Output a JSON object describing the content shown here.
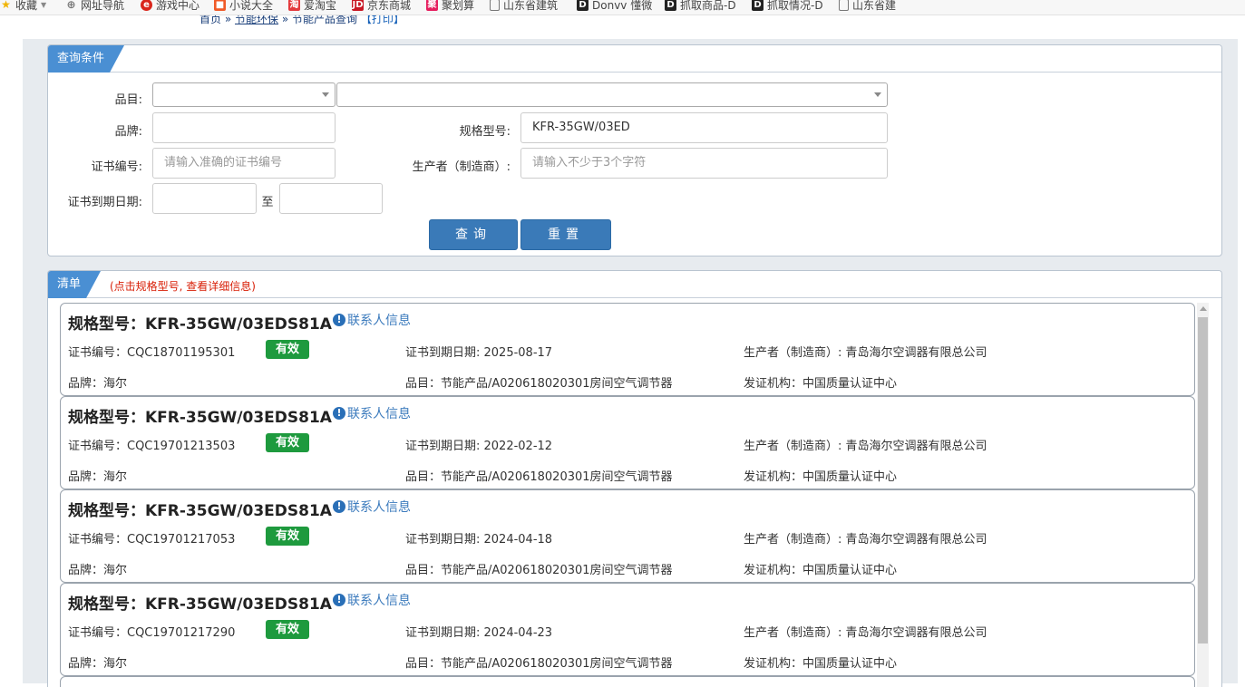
{
  "bookmarks": [
    {
      "label": "收藏",
      "icon": "star-icon",
      "color": "#f0b400"
    },
    {
      "label": "网址导航",
      "icon": "globe-icon",
      "color": "#777777"
    },
    {
      "label": "游戏中心",
      "icon": "game-icon",
      "color": "#d9261c"
    },
    {
      "label": "小说大全",
      "icon": "book-icon",
      "color": "#f05a28"
    },
    {
      "label": "爱淘宝",
      "icon": "taobao-icon",
      "color": "#e4393c"
    },
    {
      "label": "京东商城",
      "icon": "jd-icon",
      "color": "#c81623"
    },
    {
      "label": "聚划算",
      "icon": "juhuasuan-icon",
      "color": "#e61c5d"
    },
    {
      "label": "山东省建筑",
      "icon": "page-icon",
      "color": "#666666"
    },
    {
      "label": "Donvv 懂微",
      "icon": "d-logo-icon",
      "color": "#222222"
    },
    {
      "label": "抓取商品-D",
      "icon": "d-logo-icon",
      "color": "#222222"
    },
    {
      "label": "抓取情况-D",
      "icon": "d-logo-icon",
      "color": "#222222"
    },
    {
      "label": "山东省建",
      "icon": "page-icon",
      "color": "#666666"
    }
  ],
  "breadcrumb": {
    "home": "首页",
    "sep": "»",
    "section": "节能环保",
    "page": "节能产品查询",
    "print": "【打印】"
  },
  "query": {
    "title": "查询条件",
    "category_label": "品目:",
    "brand_label": "品牌:",
    "model_label": "规格型号:",
    "model_value": "KFR-35GW/03ED",
    "cert_no_label": "证书编号:",
    "cert_no_placeholder": "请输入准确的证书编号",
    "maker_label": "生产者（制造商）:",
    "maker_placeholder": "请输入不少于3个字符",
    "expiry_label": "证书到期日期:",
    "to_label": "至",
    "search_btn": "查询",
    "reset_btn": "重置"
  },
  "list": {
    "title": "清单",
    "hint": "(点击规格型号, 查看详细信息)",
    "items": [
      {
        "model": "规格型号：KFR-35GW/03EDS81A",
        "contact": "联系人信息",
        "cert": "证书编号：CQC18701195301",
        "status": "有效",
        "expiry": "证书到期日期: 2025-08-17",
        "maker": "生产者（制造商）: 青岛海尔空调器有限总公司",
        "brand": "品牌：海尔",
        "category": "品目：节能产品/A020618020301房间空气调节器",
        "issuer": "发证机构：中国质量认证中心"
      },
      {
        "model": "规格型号：KFR-35GW/03EDS81A",
        "contact": "联系人信息",
        "cert": "证书编号：CQC19701213503",
        "status": "有效",
        "expiry": "证书到期日期: 2022-02-12",
        "maker": "生产者（制造商）: 青岛海尔空调器有限总公司",
        "brand": "品牌：海尔",
        "category": "品目：节能产品/A020618020301房间空气调节器",
        "issuer": "发证机构：中国质量认证中心"
      },
      {
        "model": "规格型号：KFR-35GW/03EDS81A",
        "contact": "联系人信息",
        "cert": "证书编号：CQC19701217053",
        "status": "有效",
        "expiry": "证书到期日期: 2024-04-18",
        "maker": "生产者（制造商）: 青岛海尔空调器有限总公司",
        "brand": "品牌：海尔",
        "category": "品目：节能产品/A020618020301房间空气调节器",
        "issuer": "发证机构：中国质量认证中心"
      },
      {
        "model": "规格型号：KFR-35GW/03EDS81A",
        "contact": "联系人信息",
        "cert": "证书编号：CQC19701217290",
        "status": "有效",
        "expiry": "证书到期日期: 2024-04-23",
        "maker": "生产者（制造商）: 青岛海尔空调器有限总公司",
        "brand": "品牌：海尔",
        "category": "品目：节能产品/A020618020301房间空气调节器",
        "issuer": "发证机构：中国质量认证中心"
      }
    ]
  }
}
